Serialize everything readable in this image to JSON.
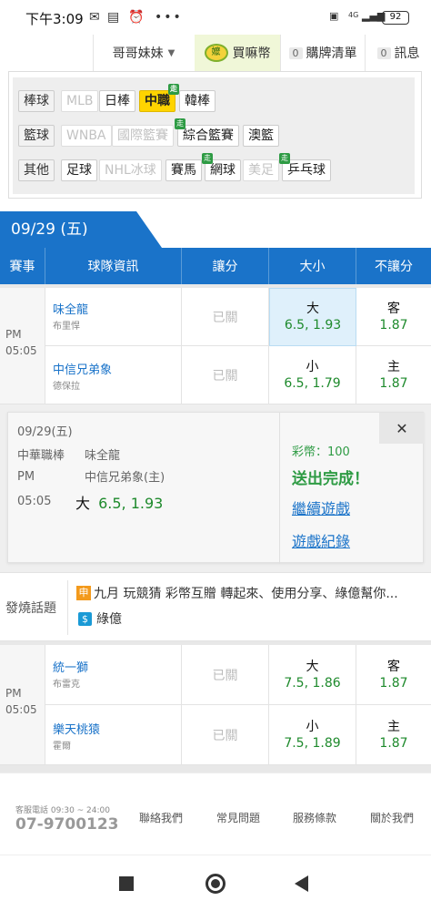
{
  "status": {
    "time": "下午3:09",
    "net1": "4G",
    "net2": "4G",
    "battery": "92"
  },
  "nav": {
    "user": "哥哥妹妹",
    "coin": "買嘛幣",
    "coin_icon_text": "嬤",
    "cart_count": "0",
    "cart": "購牌清單",
    "msg_count": "0",
    "msg": "訊息"
  },
  "filter": {
    "rows": [
      {
        "cat": "棒球",
        "items": [
          "MLB",
          "日棒",
          "中職",
          "韓棒"
        ]
      },
      {
        "cat": "籃球",
        "items": [
          "WNBA",
          "國際籃賽",
          "綜合籃賽",
          "澳籃"
        ]
      },
      {
        "cat": "其他",
        "items": [
          "足球",
          "NHL冰球",
          "賽馬",
          "網球",
          "美足",
          "乒乓球"
        ]
      }
    ],
    "tag": "走"
  },
  "date": "09/29 (五)",
  "table": {
    "headers": [
      "賽事",
      "球隊資訊",
      "讓分",
      "大小",
      "不讓分"
    ]
  },
  "games": [
    {
      "ampm": "PM",
      "time": "05:05",
      "home": {
        "team": "味全龍",
        "pitcher": "布里悍",
        "handicap": "已關",
        "ou_label": "大",
        "ou_val": "6.5, 1.93",
        "ml_label": "客",
        "ml_val": "1.87"
      },
      "away": {
        "team": "中信兄弟象",
        "pitcher": "德保拉",
        "handicap": "已關",
        "ou_label": "小",
        "ou_val": "6.5, 1.79",
        "ml_label": "主",
        "ml_val": "1.87"
      }
    },
    {
      "ampm": "PM",
      "time": "05:05",
      "home": {
        "team": "統一獅",
        "pitcher": "布雷克",
        "handicap": "已關",
        "ou_label": "大",
        "ou_val": "7.5, 1.86",
        "ml_label": "客",
        "ml_val": "1.87"
      },
      "away": {
        "team": "樂天桃猿",
        "pitcher": "霍爾",
        "handicap": "已關",
        "ou_label": "小",
        "ou_val": "7.5, 1.89",
        "ml_label": "主",
        "ml_val": "1.87"
      }
    }
  ],
  "popup": {
    "date": "09/29(五)",
    "league": "中華職棒",
    "ampm": "PM",
    "time": "05:05",
    "team1": "味全龍",
    "team2": "中信兄弟象(主)",
    "pick_label": "大",
    "pick_val": "6.5, 1.93",
    "coin_text": "彩幣：100",
    "done": "送出完成！",
    "continue": "繼續遊戲",
    "record": "遊戲紀錄",
    "close": "✕"
  },
  "hot": {
    "label": "發燒話題",
    "item1_icon": "申",
    "item1": "九月 玩競猜 彩幣互贈 轉起來、使用分享、綠億幫你...",
    "item2_icon": "$",
    "item2": "綠億"
  },
  "footer": {
    "phone_label": "客服電話 09:30 ~ 24:00",
    "phone": "07-9700123",
    "links": [
      "聯絡我們",
      "常見問題",
      "服務條款",
      "關於我們"
    ]
  },
  "colors": {
    "primary": "#1a73c9",
    "selected": "#ffd400",
    "odds": "#1e8a2c",
    "done": "#2e9b44"
  }
}
